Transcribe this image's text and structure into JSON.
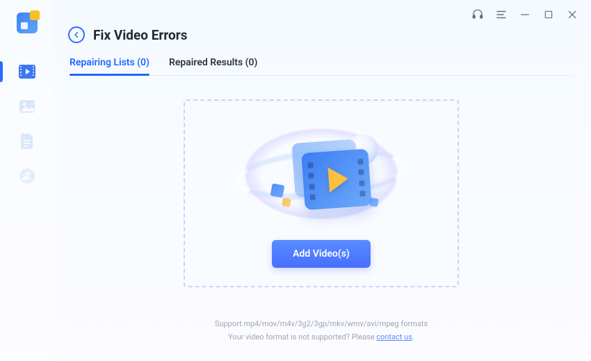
{
  "page_title": "Fix Video Errors",
  "tabs": {
    "repairing_label": "Repairing Lists (0)",
    "repaired_label": "Repaired Results (0)"
  },
  "add_button_label": "Add Video(s)",
  "footer": {
    "line1": "Support mp4/mov/m4v/3g2/3gp/mkv/wmv/avi/mpeg formats",
    "line2_prefix": "Your video format is not supported? Please ",
    "contact_label": "contact us",
    "line2_suffix": "."
  },
  "sidebar": {
    "items": [
      "video",
      "photo",
      "file",
      "audio"
    ]
  }
}
